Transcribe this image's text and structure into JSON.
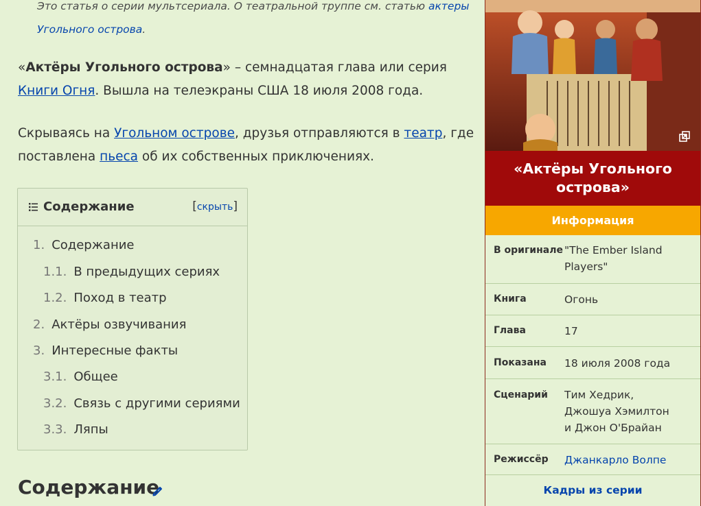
{
  "hatnote": {
    "text": "Это статья о серии мультсериала. О театральной труппе см. статью ",
    "link_line1": "актеры",
    "link_line2": "Угольного острова",
    "end": "."
  },
  "intro": {
    "open_quote": "«",
    "title_bold": "Актёры Угольного острова",
    "after_title": "» – семнадцатая глава или серия ",
    "book_link": "Книги Огня",
    "rest": ". Вышла на телеэкраны США 18 июля 2008 года."
  },
  "summary": {
    "t1": "Скрываясь на ",
    "l1": "Угольном острове",
    "t2": ", друзья отправляются в ",
    "l2": "театр",
    "t3": ", где поставлена ",
    "l3": "пьеса",
    "t4": " об их собственных приключениях."
  },
  "toc": {
    "title": "Содержание",
    "bracket_open": "[",
    "toggle": "скрыть",
    "bracket_close": "]",
    "items": [
      {
        "num": "1.",
        "label": "Содержание"
      },
      {
        "num": "1.1.",
        "label": "В предыдущих сериях"
      },
      {
        "num": "1.2.",
        "label": "Поход в театр"
      },
      {
        "num": "2.",
        "label": "Актёры озвучивания"
      },
      {
        "num": "3.",
        "label": "Интересные факты"
      },
      {
        "num": "3.1.",
        "label": "Общее"
      },
      {
        "num": "3.2.",
        "label": "Связь с другими сериями"
      },
      {
        "num": "3.3.",
        "label": "Ляпы"
      }
    ]
  },
  "section_heading": "Содержание",
  "infobox": {
    "title_line1": "«Актёры Угольного",
    "title_line2": "острова»",
    "info_header": "Информация",
    "rows": [
      {
        "label": "В оригинале",
        "value": "\"The Ember Island Players\""
      },
      {
        "label": "Книга",
        "value": "Огонь"
      },
      {
        "label": "Глава",
        "value": "17"
      },
      {
        "label": "Показана",
        "value": "18 июля 2008 года"
      },
      {
        "label": "Сценарий",
        "value": "Тим Хедрик, Джошуа Хэмилтон и Джон О'Брайан"
      },
      {
        "label": "Режиссёр",
        "value": "Джанкарло Волпе"
      }
    ],
    "footer": "Кадры из серии"
  },
  "colors": {
    "background": "#e6f2d5",
    "link": "#0645ad",
    "infobox_title_bg": "#a00a0a",
    "infobox_info_bg": "#f7a700",
    "infobox_border": "#8b2a1c"
  },
  "icons": [
    "list-icon",
    "edit-pencil-icon",
    "expand-image-icon"
  ]
}
